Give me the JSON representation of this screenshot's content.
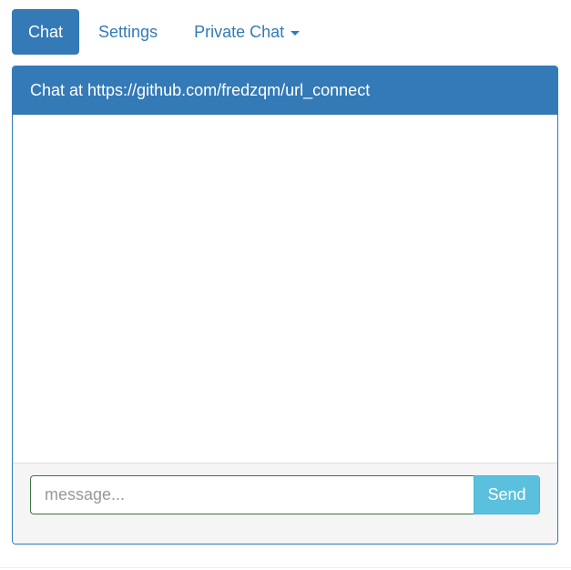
{
  "tabs": {
    "chat_label": "Chat",
    "settings_label": "Settings",
    "private_chat_label": "Private Chat"
  },
  "panel": {
    "title": "Chat at https://github.com/fredzqm/url_connect"
  },
  "composer": {
    "placeholder": "message...",
    "value": "",
    "send_label": "Send"
  },
  "colors": {
    "primary": "#337ab7",
    "send_button": "#5bc0de",
    "input_border": "#3c763d",
    "footer_bg": "#f5f5f5"
  },
  "icons": {
    "dropdown": "caret-down-icon"
  }
}
